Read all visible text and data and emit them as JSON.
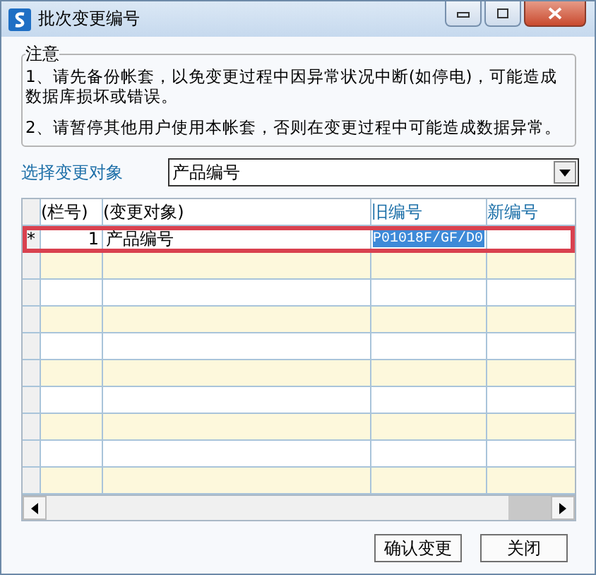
{
  "window": {
    "title": "批次变更编号"
  },
  "notice": {
    "legend": "注意",
    "items": [
      "1、请先备份帐套，以免变更过程中因异常状况中断(如停电)，可能造成数据库损坏或错误。",
      "2、请暂停其他用户使用本帐套，否则在变更过程中可能造成数据异常。"
    ]
  },
  "target": {
    "label": "选择变更对象",
    "value": "产品编号"
  },
  "table": {
    "columns": [
      {
        "label": "(栏号)",
        "accent": false
      },
      {
        "label": "(变更对象)",
        "accent": false
      },
      {
        "label": "旧编号",
        "accent": true
      },
      {
        "label": "新编号",
        "accent": true
      }
    ],
    "rows": [
      {
        "marker": "*",
        "highlighted": true,
        "cells": [
          {
            "text": "1",
            "selected": false
          },
          {
            "text": "产品编号",
            "selected": false
          },
          {
            "text": "P01018F/GF/D0",
            "selected": true
          }
        ]
      }
    ]
  },
  "buttons": [
    "确认变更",
    "关闭"
  ]
}
